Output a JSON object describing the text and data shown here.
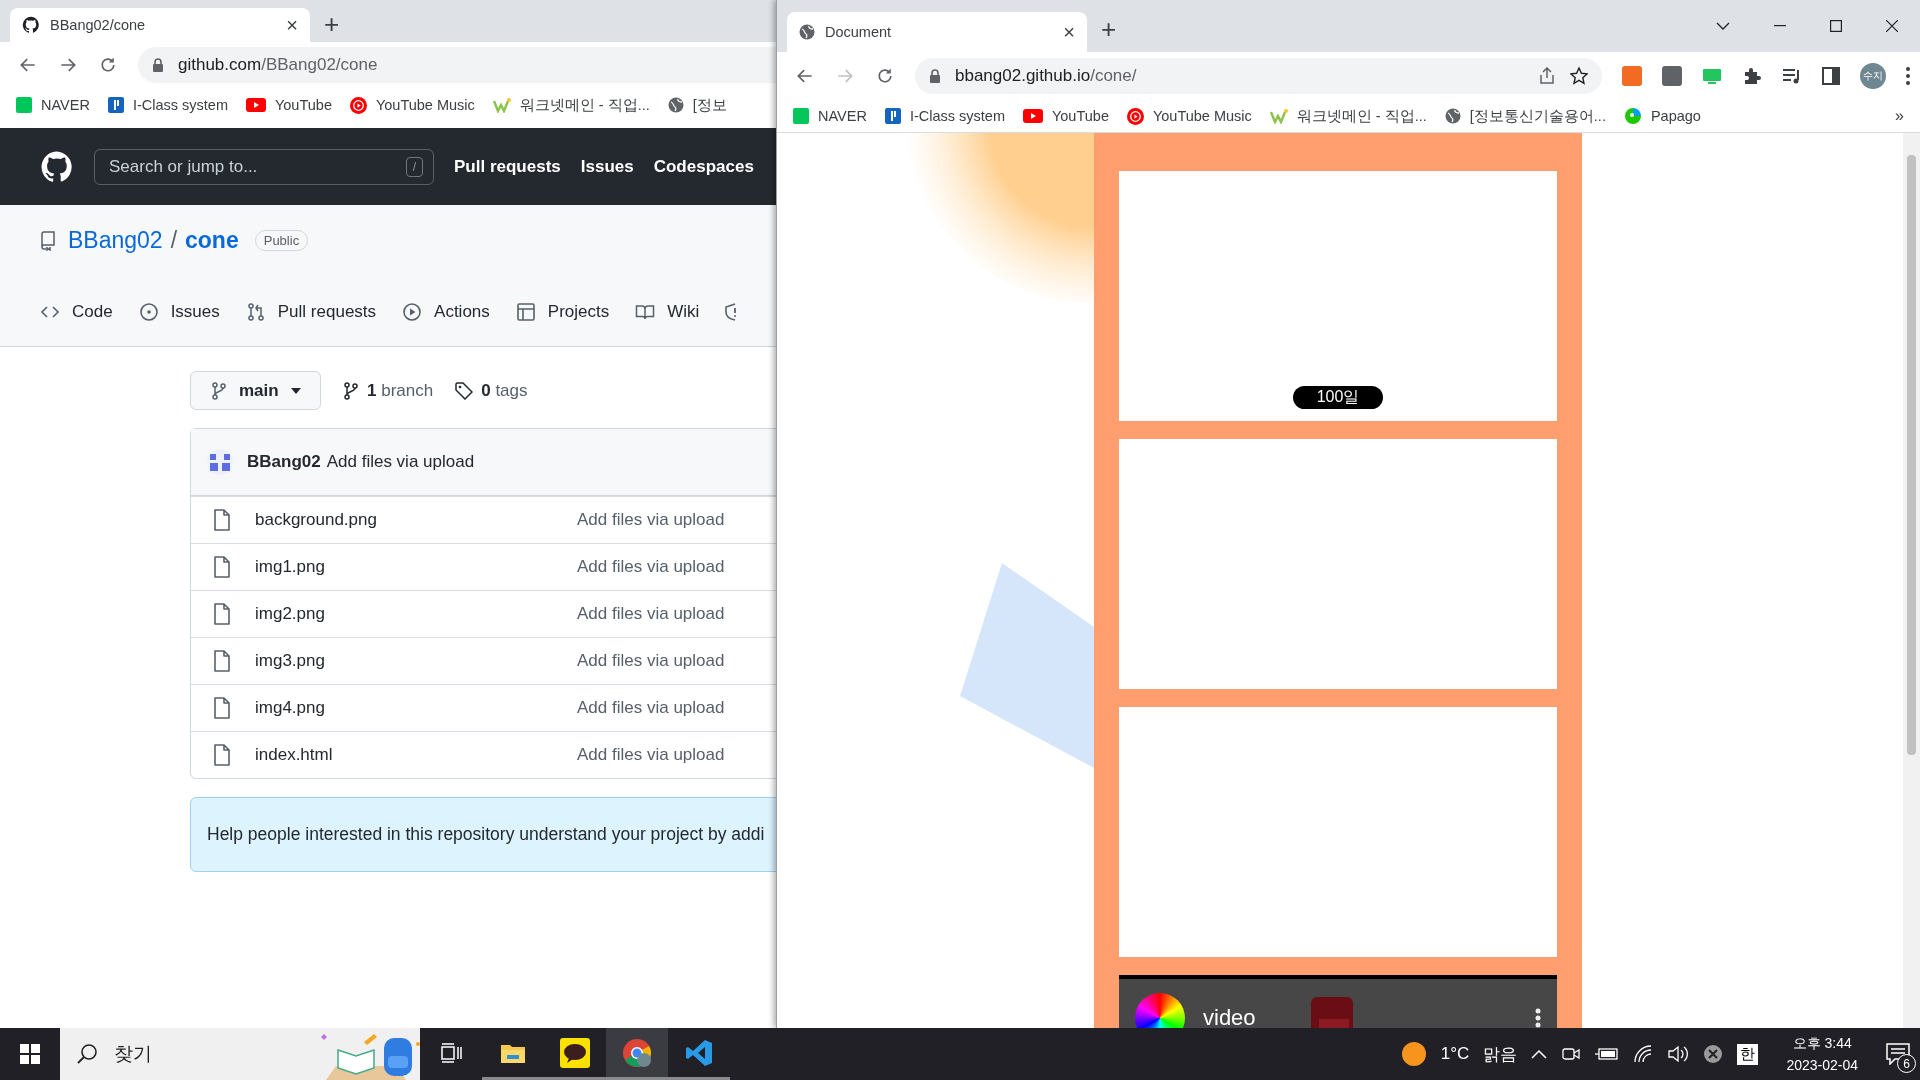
{
  "left_window": {
    "tab": {
      "title": "BBang02/cone",
      "close": "×"
    },
    "new_tab": "+",
    "address": {
      "host": "github.com",
      "path": "/BBang02/cone"
    },
    "bookmarks": [
      {
        "kind": "naver",
        "label": "NAVER"
      },
      {
        "kind": "iclass",
        "label": "I-Class system"
      },
      {
        "kind": "youtube",
        "label": "YouTube"
      },
      {
        "kind": "ytmusic",
        "label": "YouTube Music"
      },
      {
        "kind": "worknet",
        "label": "워크넷메인 - 직업..."
      },
      {
        "kind": "globe",
        "label": "[정보"
      }
    ],
    "github": {
      "search_placeholder": "Search or jump to...",
      "search_key": "/",
      "nav": [
        "Pull requests",
        "Issues",
        "Codespaces"
      ],
      "owner": "BBang02",
      "separator": "/",
      "repo": "cone",
      "visibility": "Public",
      "tabs": [
        {
          "kind": "code",
          "label": "Code"
        },
        {
          "kind": "issues",
          "label": "Issues"
        },
        {
          "kind": "pulls",
          "label": "Pull requests"
        },
        {
          "kind": "actions",
          "label": "Actions"
        },
        {
          "kind": "projects",
          "label": "Projects"
        },
        {
          "kind": "wiki",
          "label": "Wiki"
        },
        {
          "kind": "security"
        }
      ],
      "branch": "main",
      "branch_count": "1",
      "branch_label": "branch",
      "tag_count": "0",
      "tag_label": "tags",
      "commit": {
        "author": "BBang02",
        "message": "Add files via upload"
      },
      "files": [
        {
          "name": "background.png",
          "message": "Add files via upload"
        },
        {
          "name": "img1.png",
          "message": "Add files via upload"
        },
        {
          "name": "img2.png",
          "message": "Add files via upload"
        },
        {
          "name": "img3.png",
          "message": "Add files via upload"
        },
        {
          "name": "img4.png",
          "message": "Add files via upload"
        },
        {
          "name": "index.html",
          "message": "Add files via upload"
        }
      ],
      "readme_hint": "Help people interested in this repository understand your project by addi"
    }
  },
  "right_window": {
    "tab": {
      "title": "Document",
      "close": "×"
    },
    "new_tab": "+",
    "address": {
      "host": "bbang02.github.io",
      "path": "/cone/"
    },
    "profile": "수지",
    "bookmarks": [
      {
        "kind": "naver",
        "label": "NAVER"
      },
      {
        "kind": "iclass",
        "label": "I-Class system"
      },
      {
        "kind": "youtube",
        "label": "YouTube"
      },
      {
        "kind": "ytmusic",
        "label": "YouTube Music"
      },
      {
        "kind": "worknet",
        "label": "워크넷메인 - 직업..."
      },
      {
        "kind": "globe",
        "label": "[정보통신기술용어..."
      },
      {
        "kind": "papago",
        "label": "Papago"
      }
    ],
    "bookmarks_more": "»",
    "page": {
      "cards": [
        {
          "kind": "badge",
          "badge": "100일"
        },
        {
          "kind": "blank"
        },
        {
          "kind": "blank"
        }
      ],
      "video": {
        "title": "video"
      }
    }
  },
  "taskbar": {
    "search": "찾기",
    "weather": {
      "temp": "1°C",
      "condition": "맑음"
    },
    "ime": "한",
    "time": "오후 3:44",
    "date": "2023-02-04",
    "notifications": "6"
  }
}
